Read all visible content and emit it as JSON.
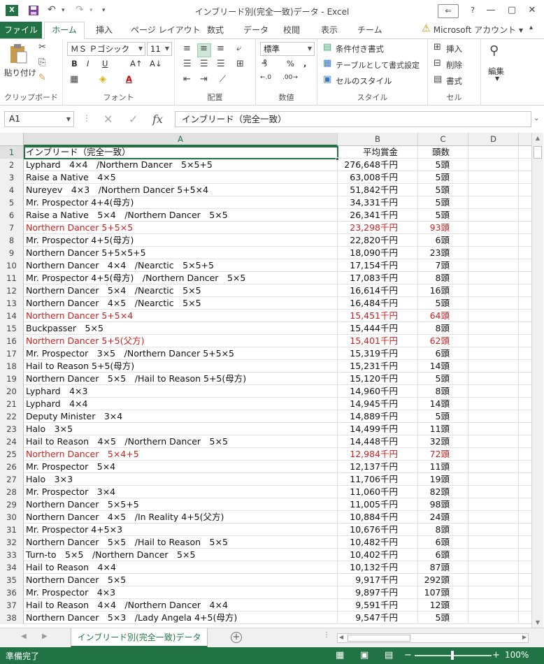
{
  "window": {
    "title": "インブリード別(完全一致)データ - Excel",
    "logo": "X",
    "qat_undo_icon": "↶",
    "qat_redo_icon": "↷",
    "qat_more_icon": "▾",
    "help_icon": "?",
    "ribbon_display_icon": "⇐",
    "minimize_icon": "—",
    "restore_icon": "▢",
    "close_icon": "✕"
  },
  "tabs": {
    "file": "ファイル",
    "home": "ホーム",
    "insert": "挿入",
    "page_layout": "ページ レイアウト",
    "formulas": "数式",
    "data": "データ",
    "review": "校閲",
    "view": "表示",
    "team": "チーム",
    "account": "Microsoft アカウント ▾",
    "warning_icon": "⚠"
  },
  "ribbon": {
    "clipboard": {
      "label": "クリップボード",
      "paste": "貼り付け"
    },
    "font": {
      "label": "フォント",
      "family": "ＭＳ Ｐゴシック",
      "size": "11",
      "bold": "B",
      "italic": "I",
      "underline": "U",
      "grow": "A↑",
      "shrink": "A↓",
      "color_a": "A"
    },
    "alignment": {
      "label": "配置"
    },
    "number": {
      "label": "数値",
      "format": "標準",
      "percent": "%",
      "comma": ",",
      "inc_dec": "←.0",
      "dec_dec": ".00→"
    },
    "styles": {
      "label": "スタイル",
      "conditional": "条件付き書式",
      "table": "テーブルとして書式設定",
      "cell_styles": "セルのスタイル"
    },
    "cells": {
      "label": "セル",
      "insert": "挿入",
      "delete": "削除",
      "format": "書式"
    },
    "editing": {
      "label": "編集"
    }
  },
  "formula_bar": {
    "name_box": "A1",
    "cancel_icon": "✕",
    "enter_icon": "✓",
    "fx": "fx",
    "content": "インブリード（完全一致）"
  },
  "columns": [
    "A",
    "B",
    "C",
    "D"
  ],
  "rows": [
    {
      "n": "1",
      "a": "インブリード（完全一致）",
      "b": "平均賞金",
      "c": "頭数",
      "red": false,
      "header": true
    },
    {
      "n": "2",
      "a": "Lyphard　4×4　/Northern Dancer　5×5+5",
      "b": "276,648千円",
      "c": "5頭",
      "red": false
    },
    {
      "n": "3",
      "a": "Raise a Native　4×5",
      "b": "63,008千円",
      "c": "5頭",
      "red": false
    },
    {
      "n": "4",
      "a": "Nureyev　4×3　/Northern Dancer 5+5×4",
      "b": "51,842千円",
      "c": "5頭",
      "red": false
    },
    {
      "n": "5",
      "a": "Mr. Prospector 4+4(母方)",
      "b": "34,331千円",
      "c": "5頭",
      "red": false
    },
    {
      "n": "6",
      "a": "Raise a Native　5×4　/Northern Dancer　5×5",
      "b": "26,341千円",
      "c": "5頭",
      "red": false
    },
    {
      "n": "7",
      "a": "Northern Dancer 5+5×5",
      "b": "23,298千円",
      "c": "93頭",
      "red": true
    },
    {
      "n": "8",
      "a": "Mr. Prospector 4+5(母方)",
      "b": "22,820千円",
      "c": "6頭",
      "red": false
    },
    {
      "n": "9",
      "a": "Northern Dancer 5+5×5+5",
      "b": "18,090千円",
      "c": "23頭",
      "red": false
    },
    {
      "n": "10",
      "a": "Northern Dancer　4×4　/Nearctic　5×5+5",
      "b": "17,154千円",
      "c": "7頭",
      "red": false
    },
    {
      "n": "11",
      "a": "Mr. Prospector 4+5(母方)　/Northern Dancer　5×5",
      "b": "17,083千円",
      "c": "8頭",
      "red": false
    },
    {
      "n": "12",
      "a": "Northern Dancer　5×4　/Nearctic　5×5",
      "b": "16,614千円",
      "c": "16頭",
      "red": false
    },
    {
      "n": "13",
      "a": "Northern Dancer　4×5　/Nearctic　5×5",
      "b": "16,484千円",
      "c": "5頭",
      "red": false
    },
    {
      "n": "14",
      "a": "Northern Dancer 5+5×4",
      "b": "15,451千円",
      "c": "64頭",
      "red": true
    },
    {
      "n": "15",
      "a": "Buckpasser　5×5",
      "b": "15,444千円",
      "c": "8頭",
      "red": false
    },
    {
      "n": "16",
      "a": "Northern Dancer 5+5(父方)",
      "b": "15,401千円",
      "c": "62頭",
      "red": true
    },
    {
      "n": "17",
      "a": "Mr. Prospector　3×5　/Northern Dancer 5+5×5",
      "b": "15,319千円",
      "c": "6頭",
      "red": false
    },
    {
      "n": "18",
      "a": "Hail to Reason 5+5(母方)",
      "b": "15,231千円",
      "c": "14頭",
      "red": false
    },
    {
      "n": "19",
      "a": "Northern Dancer　5×5　/Hail to Reason 5+5(母方)",
      "b": "15,120千円",
      "c": "5頭",
      "red": false
    },
    {
      "n": "20",
      "a": "Lyphard　4×3",
      "b": "14,960千円",
      "c": "8頭",
      "red": false
    },
    {
      "n": "21",
      "a": "Lyphard　4×4",
      "b": "14,945千円",
      "c": "14頭",
      "red": false
    },
    {
      "n": "22",
      "a": "Deputy Minister　3×4",
      "b": "14,889千円",
      "c": "5頭",
      "red": false
    },
    {
      "n": "23",
      "a": "Halo　3×5",
      "b": "14,499千円",
      "c": "11頭",
      "red": false
    },
    {
      "n": "24",
      "a": "Hail to Reason　4×5　/Northern Dancer　5×5",
      "b": "14,448千円",
      "c": "32頭",
      "red": false
    },
    {
      "n": "25",
      "a": "Northern Dancer　5×4+5",
      "b": "12,984千円",
      "c": "72頭",
      "red": true
    },
    {
      "n": "26",
      "a": "Mr. Prospector　5×4",
      "b": "12,137千円",
      "c": "11頭",
      "red": false
    },
    {
      "n": "27",
      "a": "Halo　3×3",
      "b": "11,706千円",
      "c": "19頭",
      "red": false
    },
    {
      "n": "28",
      "a": "Mr. Prospector　3×4",
      "b": "11,060千円",
      "c": "82頭",
      "red": false
    },
    {
      "n": "29",
      "a": "Northern Dancer　5×5+5",
      "b": "11,005千円",
      "c": "98頭",
      "red": false
    },
    {
      "n": "30",
      "a": "Northern Dancer　4×5　/In Reality 4+5(父方)",
      "b": "10,884千円",
      "c": "24頭",
      "red": false
    },
    {
      "n": "31",
      "a": "Mr. Prospector 4+5×3",
      "b": "10,676千円",
      "c": "8頭",
      "red": false
    },
    {
      "n": "32",
      "a": "Northern Dancer　5×5　/Hail to Reason　5×5",
      "b": "10,482千円",
      "c": "6頭",
      "red": false
    },
    {
      "n": "33",
      "a": "Turn-to　5×5　/Northern Dancer　5×5",
      "b": "10,402千円",
      "c": "6頭",
      "red": false
    },
    {
      "n": "34",
      "a": "Hail to Reason　4×4",
      "b": "10,132千円",
      "c": "87頭",
      "red": false
    },
    {
      "n": "35",
      "a": "Northern Dancer　5×5",
      "b": "9,917千円",
      "c": "292頭",
      "red": false
    },
    {
      "n": "36",
      "a": "Mr. Prospector　4×3",
      "b": "9,897千円",
      "c": "107頭",
      "red": false
    },
    {
      "n": "37",
      "a": "Hail to Reason　4×4　/Northern Dancer　4×4",
      "b": "9,591千円",
      "c": "12頭",
      "red": false
    },
    {
      "n": "38",
      "a": "Northern Dancer　5×3　/Lady Angela 4+5(母方)",
      "b": "9,547千円",
      "c": "5頭",
      "red": false
    }
  ],
  "sheet": {
    "tab": "インブリード別(完全一致)データ",
    "add_icon": "+",
    "prev_icon": "◀",
    "next_icon": "▶",
    "dots": "..."
  },
  "status": {
    "ready": "準備完了",
    "zoom": "100%",
    "minus": "−",
    "plus": "+"
  },
  "colors": {
    "excel_green": "#217346",
    "highlight_red": "#d21f1f"
  }
}
